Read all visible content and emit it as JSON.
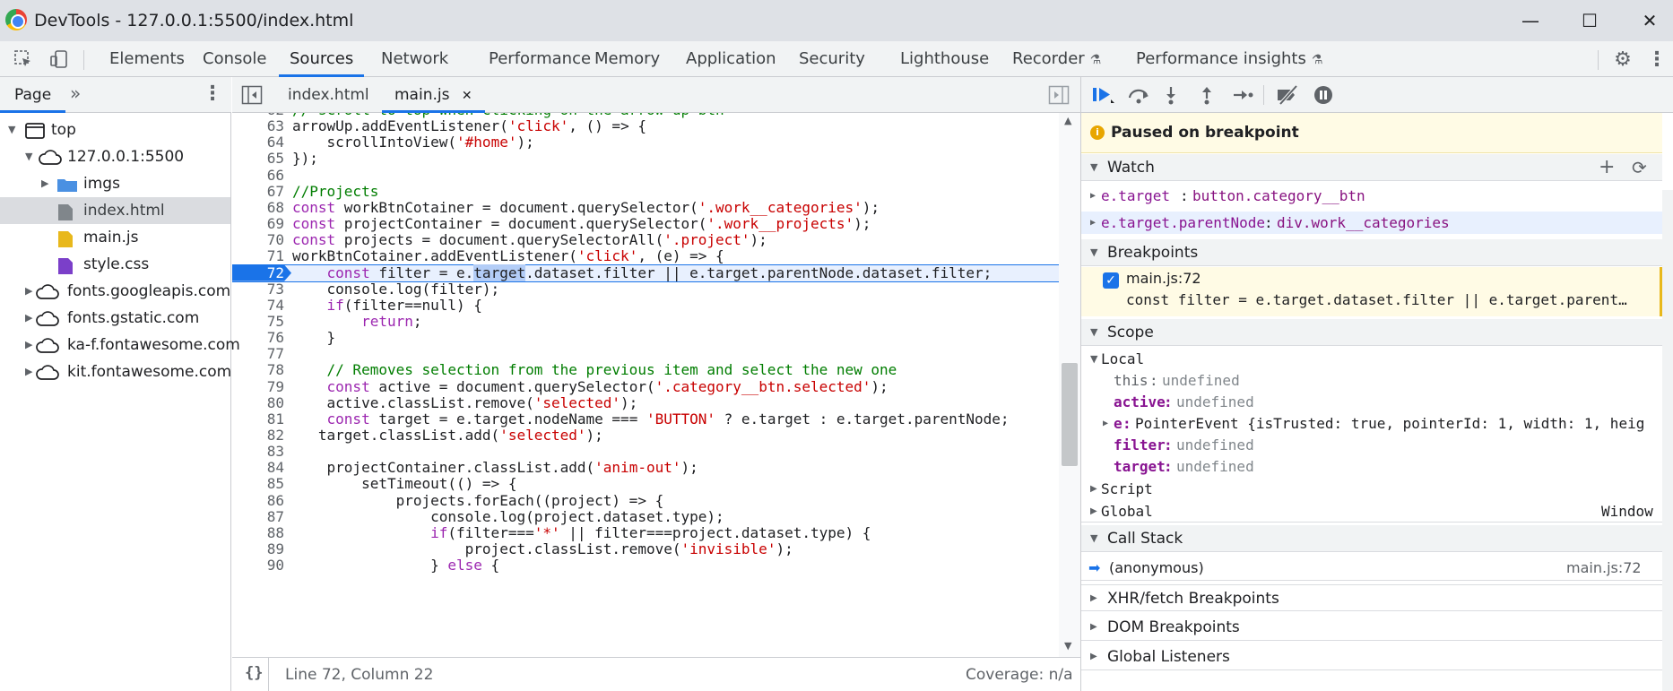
{
  "window": {
    "title": "DevTools - 127.0.0.1:5500/index.html",
    "minimize": "—",
    "maximize": "☐",
    "close": "✕"
  },
  "panel_tabs": [
    "Elements",
    "Console",
    "Sources",
    "Network",
    "Performance",
    "Memory",
    "Application",
    "Security",
    "Lighthouse",
    "Recorder",
    "Performance insights"
  ],
  "active_panel_tab": "Sources",
  "navigator": {
    "tab_label": "Page",
    "more": "»",
    "tree": [
      {
        "label": "top",
        "icon": "frame-icon"
      },
      {
        "label": "127.0.0.1:5500",
        "icon": "cloud-icon"
      },
      {
        "label": "imgs",
        "icon": "folder-icon"
      },
      {
        "label": "index.html",
        "icon": "file-icon"
      },
      {
        "label": "main.js",
        "icon": "js-file-icon"
      },
      {
        "label": "style.css",
        "icon": "css-file-icon"
      },
      {
        "label": "fonts.googleapis.com",
        "icon": "cloud-icon"
      },
      {
        "label": "fonts.gstatic.com",
        "icon": "cloud-icon"
      },
      {
        "label": "ka-f.fontawesome.com",
        "icon": "cloud-icon"
      },
      {
        "label": "kit.fontawesome.com",
        "icon": "cloud-icon"
      }
    ]
  },
  "editor": {
    "tabs": [
      {
        "label": "index.html"
      },
      {
        "label": "main.js",
        "close": "✕"
      }
    ],
    "lines": [
      {
        "n": "62",
        "t": "// scroll to top when clicking on the arrow-up btn"
      },
      {
        "n": "63",
        "t": "arrowUp.addEventListener('click', () => {"
      },
      {
        "n": "64",
        "t": "    scrollIntoView('#home');"
      },
      {
        "n": "65",
        "t": "});"
      },
      {
        "n": "66",
        "t": ""
      },
      {
        "n": "67",
        "t": "//Projects"
      },
      {
        "n": "68",
        "t": "const workBtnCotainer = document.querySelector('.work__categories');"
      },
      {
        "n": "69",
        "t": "const projectContainer = document.querySelector('.work__projects');"
      },
      {
        "n": "70",
        "t": "const projects = document.querySelectorAll('.project');"
      },
      {
        "n": "71",
        "t": "workBtnCotainer.addEventListener('click', (e) => {"
      },
      {
        "n": "72",
        "t": "    const filter = e.target.dataset.filter || e.target.parentNode.dataset.filter;"
      },
      {
        "n": "73",
        "t": "    console.log(filter);"
      },
      {
        "n": "74",
        "t": "    if(filter==null) {"
      },
      {
        "n": "75",
        "t": "        return;"
      },
      {
        "n": "76",
        "t": "    }"
      },
      {
        "n": "77",
        "t": ""
      },
      {
        "n": "78",
        "t": "    // Removes selection from the previous item and select the new one"
      },
      {
        "n": "79",
        "t": "    const active = document.querySelector('.category__btn.selected');"
      },
      {
        "n": "80",
        "t": "    active.classList.remove('selected');"
      },
      {
        "n": "81",
        "t": "    const target = e.target.nodeName === 'BUTTON' ? e.target : e.target.parentNode;"
      },
      {
        "n": "82",
        "t": "   target.classList.add('selected');"
      },
      {
        "n": "83",
        "t": ""
      },
      {
        "n": "84",
        "t": "    projectContainer.classList.add('anim-out');"
      },
      {
        "n": "85",
        "t": "        setTimeout(() => {"
      },
      {
        "n": "86",
        "t": "            projects.forEach((project) => {"
      },
      {
        "n": "87",
        "t": "                console.log(project.dataset.type);"
      },
      {
        "n": "88",
        "t": "                if(filter==='*' || filter===project.dataset.type) {"
      },
      {
        "n": "89",
        "t": "                    project.classList.remove('invisible');"
      },
      {
        "n": "90",
        "t": "                } else {"
      }
    ],
    "breakpoint_line": "72",
    "status": {
      "braces": "{}",
      "position": "Line 72, Column 22",
      "coverage": "Coverage: n/a"
    }
  },
  "debugger": {
    "paused_message": "Paused on breakpoint",
    "watch": {
      "title": "Watch",
      "add": "+",
      "refresh": "⟳",
      "items": [
        {
          "expr": "e.target",
          "value": "button.category__btn"
        },
        {
          "expr": "e.target.parentNode",
          "value": "div.work__categories"
        }
      ]
    },
    "breakpoints": {
      "title": "Breakpoints",
      "item_location": "main.js:72",
      "item_code": "const filter = e.target.dataset.filter || e.target.parent…"
    },
    "scope": {
      "title": "Scope",
      "local_title": "Local",
      "locals": [
        {
          "name": "this",
          "value": "undefined",
          "bold": false
        },
        {
          "name": "active",
          "value": "undefined",
          "bold": true
        },
        {
          "name": "e",
          "value": "PointerEvent {isTrusted: true, pointerId: 1, width: 1, heig",
          "bold": true
        },
        {
          "name": "filter",
          "value": "undefined",
          "bold": true
        },
        {
          "name": "target",
          "value": "undefined",
          "bold": true
        }
      ],
      "script_title": "Script",
      "global_title": "Global",
      "global_value": "Window"
    },
    "call_stack": {
      "title": "Call Stack",
      "frame_name": "(anonymous)",
      "frame_location": "main.js:72"
    },
    "xhr_title": "XHR/fetch Breakpoints",
    "dom_title": "DOM Breakpoints",
    "listeners_title": "Global Listeners"
  },
  "colors": {
    "accent": "#1a73e8",
    "paused_bg": "#fffbe5",
    "string": "#c80000",
    "keyword": "#9c27b0",
    "comment": "#007d00"
  }
}
